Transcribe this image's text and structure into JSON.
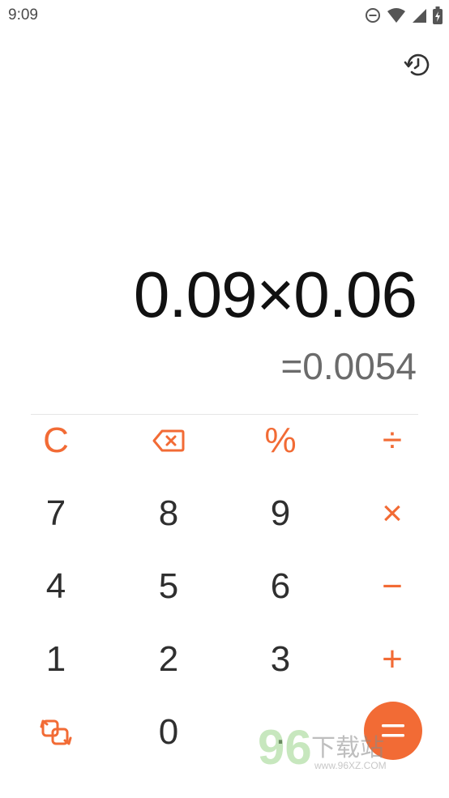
{
  "status_bar": {
    "time": "9:09"
  },
  "display": {
    "expression": "0.09×0.06",
    "result": "=0.0054"
  },
  "keypad": {
    "row_functions": {
      "clear": "C",
      "percent": "%",
      "divide": "÷"
    },
    "row1": [
      "7",
      "8",
      "9"
    ],
    "row2": [
      "4",
      "5",
      "6"
    ],
    "row3": [
      "1",
      "2",
      "3"
    ],
    "row4": {
      "zero": "0",
      "decimal": "."
    },
    "operators": {
      "multiply": "×",
      "minus": "−",
      "plus": "+"
    }
  },
  "colors": {
    "accent": "#f26b35",
    "digit": "#2f2f2f",
    "expression": "#111111",
    "result": "#6b6b6b"
  },
  "watermark": {
    "digits": "96",
    "text": "下载站",
    "url": "www.96XZ.COM"
  }
}
